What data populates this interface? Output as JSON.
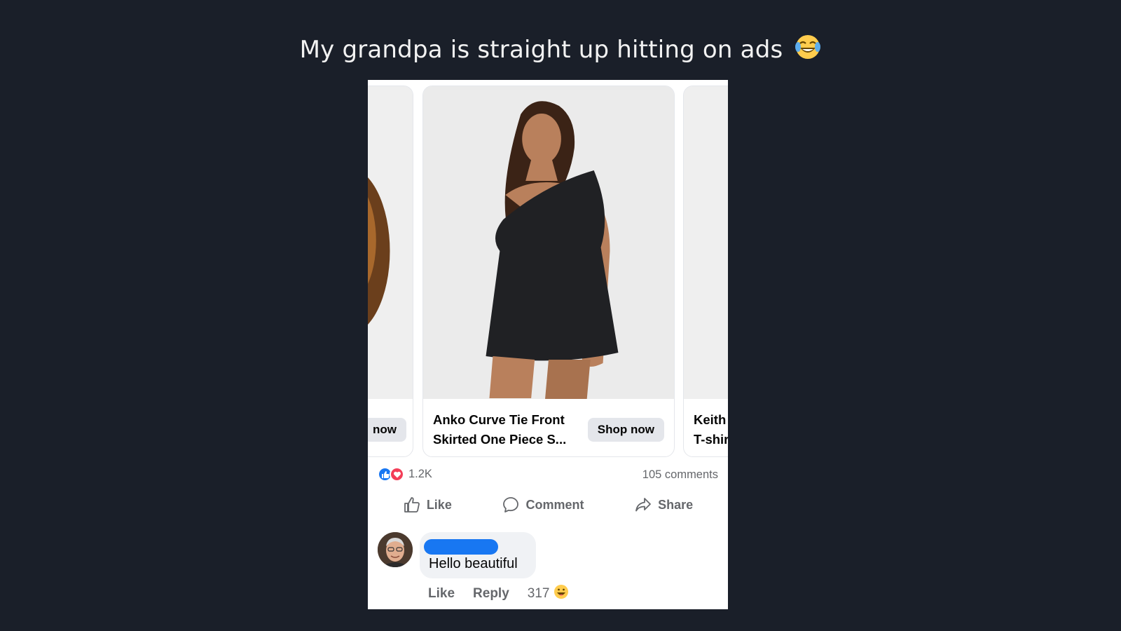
{
  "caption": {
    "text": "My grandpa is straight up hitting on ads",
    "emoji": "laughing-tears-emoji"
  },
  "carousel": {
    "left_card": {
      "button_label": "now"
    },
    "main_card": {
      "title_line1": "Anko Curve Tie Front",
      "title_line2": "Skirted One Piece S...",
      "button_label": "Shop now"
    },
    "right_card": {
      "title_line1": "Keith",
      "title_line2": "T-shir"
    }
  },
  "stats": {
    "reaction_count": "1.2K",
    "comments_count": "105 comments",
    "reaction_icons": [
      "like-reaction-icon",
      "love-reaction-icon"
    ]
  },
  "actions": {
    "like": "Like",
    "comment": "Comment",
    "share": "Share"
  },
  "comment": {
    "text": "Hello beautiful",
    "like_label": "Like",
    "reply_label": "Reply",
    "reaction_count": "317",
    "reaction_icon": "grinning-emoji"
  },
  "colors": {
    "background": "#1a1f29",
    "accent": "#1877f2",
    "love": "#f33e58",
    "muted": "#65676b"
  }
}
